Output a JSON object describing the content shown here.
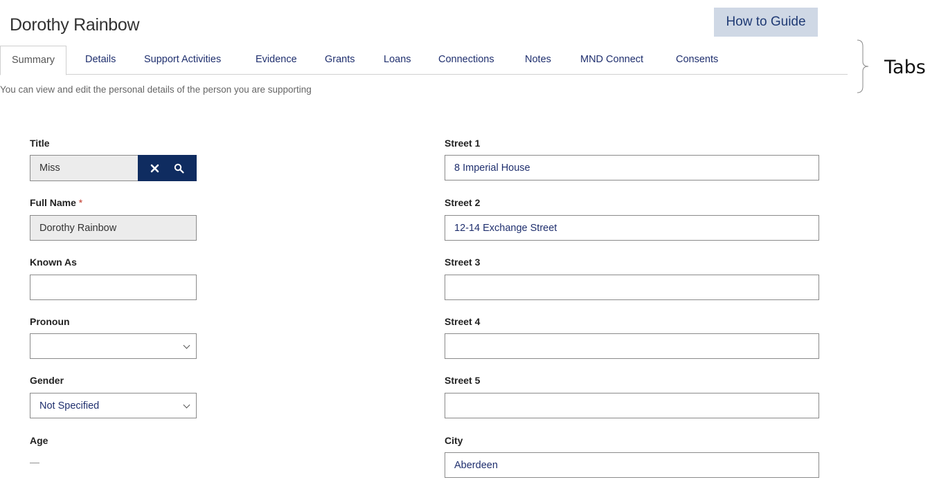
{
  "header": {
    "title": "Dorothy Rainbow",
    "guide_button": "How to Guide"
  },
  "tabs": [
    {
      "label": "Summary",
      "active": true
    },
    {
      "label": "Details"
    },
    {
      "label": "Support Activities"
    },
    {
      "label": "Evidence"
    },
    {
      "label": "Grants"
    },
    {
      "label": "Loans"
    },
    {
      "label": "Connections"
    },
    {
      "label": "Notes"
    },
    {
      "label": "MND Connect"
    },
    {
      "label": "Consents"
    }
  ],
  "annotation": "Tabs",
  "subtitle": "You can view and edit the personal details of the person you are supporting",
  "left_form": {
    "title": {
      "label": "Title",
      "value": "Miss"
    },
    "full_name": {
      "label": "Full Name",
      "required_mark": "*",
      "value": "Dorothy Rainbow"
    },
    "known_as": {
      "label": "Known As",
      "value": ""
    },
    "pronoun": {
      "label": "Pronoun",
      "value": ""
    },
    "gender": {
      "label": "Gender",
      "value": "Not Specified"
    },
    "age": {
      "label": "Age",
      "value": "—"
    }
  },
  "right_form": {
    "street1": {
      "label": "Street 1",
      "value": "8 Imperial House"
    },
    "street2": {
      "label": "Street 2",
      "value": "12-14 Exchange Street"
    },
    "street3": {
      "label": "Street 3",
      "value": ""
    },
    "street4": {
      "label": "Street 4",
      "value": ""
    },
    "street5": {
      "label": "Street 5",
      "value": ""
    },
    "city": {
      "label": "City",
      "value": "Aberdeen"
    }
  },
  "icons": {
    "clear": "close-icon",
    "search": "search-icon",
    "dropdown": "chevron-down-icon"
  },
  "colors": {
    "primary_dark": "#0f2c60",
    "link": "#1f2f6e",
    "guide_bg": "#cfd8e5",
    "required": "#c0392b"
  }
}
